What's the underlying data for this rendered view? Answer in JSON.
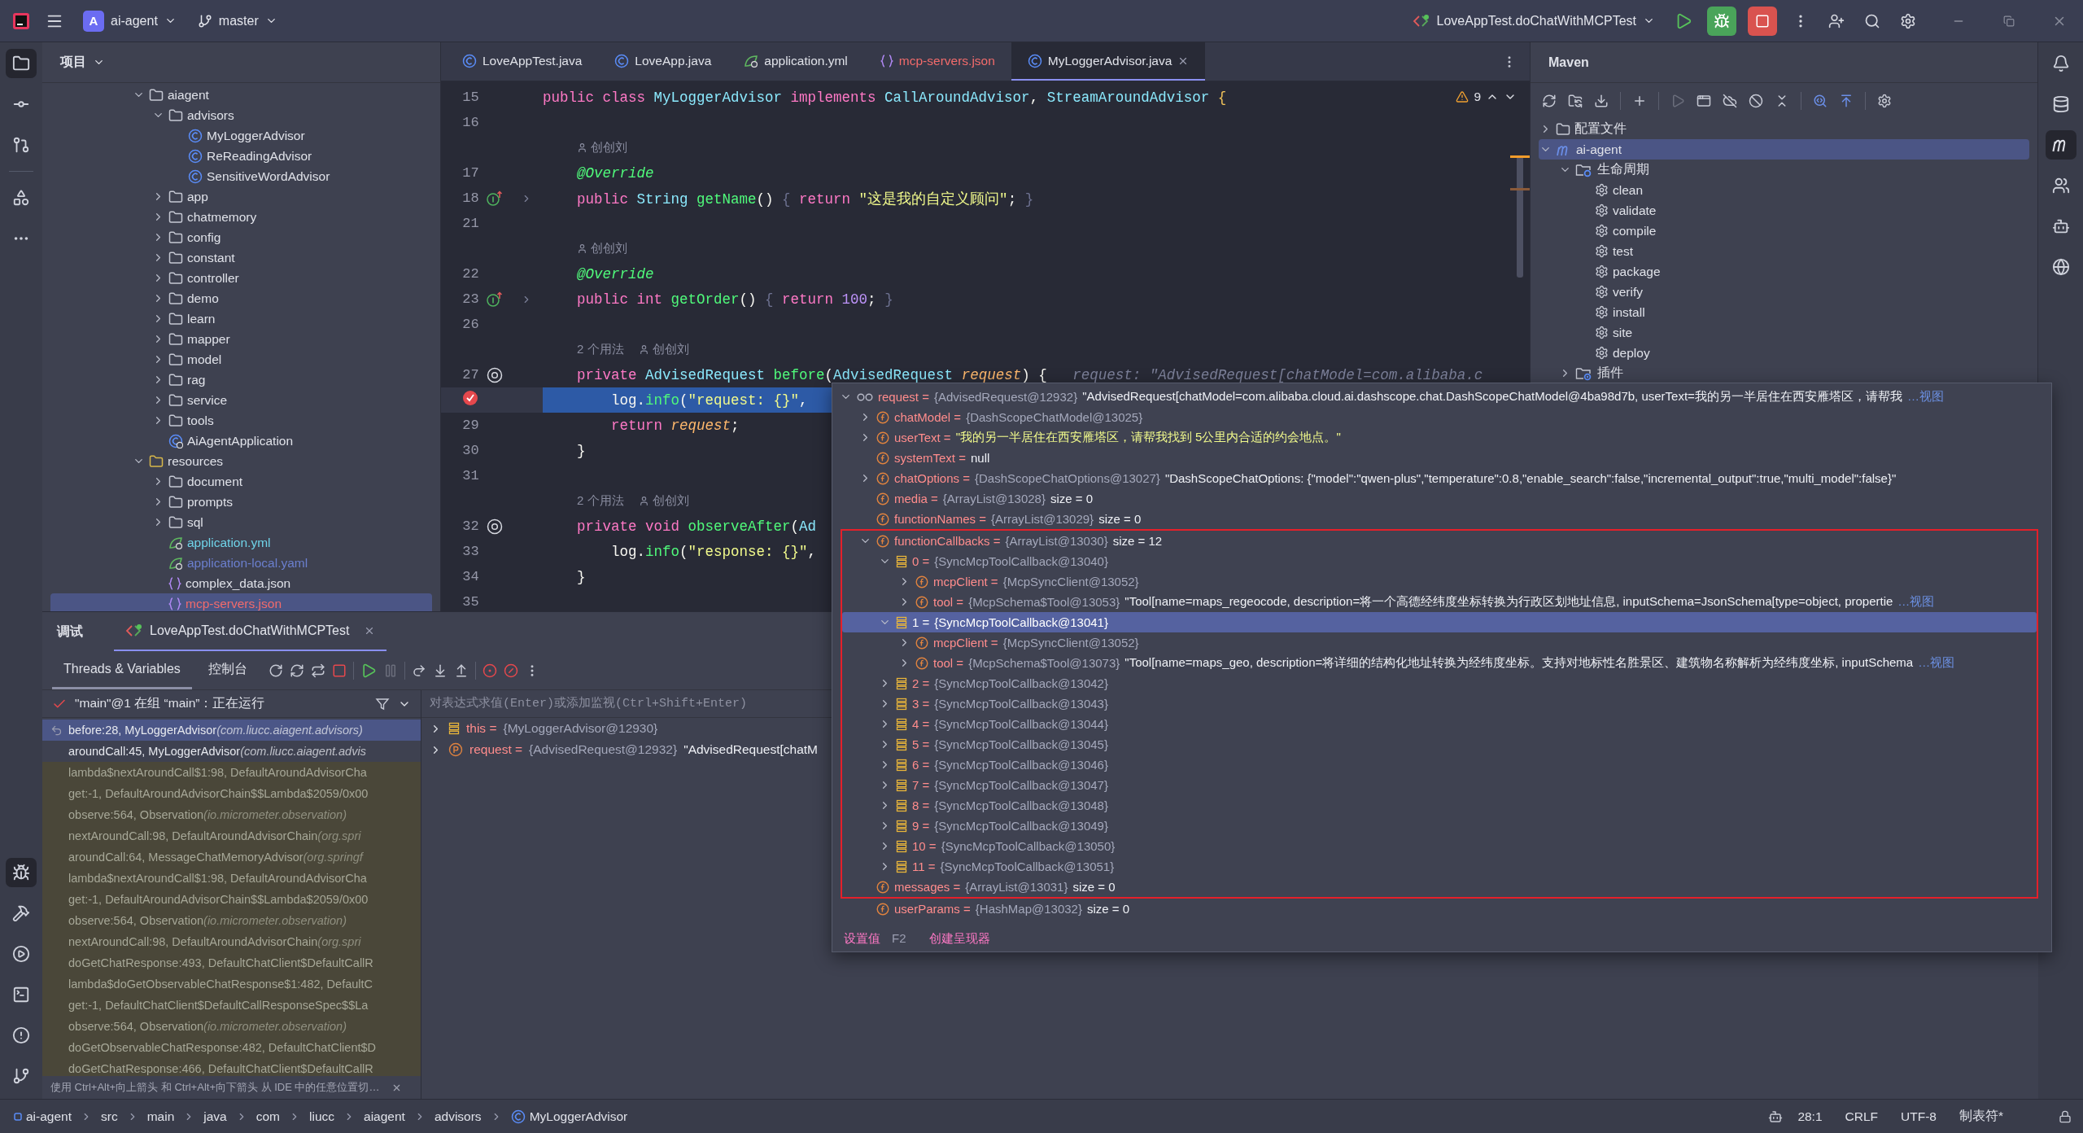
{
  "title_bar": {
    "project_badge": "A",
    "project": "ai-agent",
    "branch": "master",
    "run_config": "LoveAppTest.doChatWithMCPTest"
  },
  "project_panel": {
    "title": "项目",
    "tree": [
      {
        "label": "aiagent",
        "kind": "package",
        "expanded": true,
        "children": [
          {
            "label": "advisors",
            "kind": "package",
            "expanded": true,
            "children": [
              {
                "label": "MyLoggerAdvisor",
                "kind": "class"
              },
              {
                "label": "ReReadingAdvisor",
                "kind": "class"
              },
              {
                "label": "SensitiveWordAdvisor",
                "kind": "class"
              }
            ]
          },
          {
            "label": "app",
            "kind": "package",
            "expanded": false
          },
          {
            "label": "chatmemory",
            "kind": "package",
            "expanded": false
          },
          {
            "label": "config",
            "kind": "package",
            "expanded": false
          },
          {
            "label": "constant",
            "kind": "package",
            "expanded": false
          },
          {
            "label": "controller",
            "kind": "package",
            "expanded": false
          },
          {
            "label": "demo",
            "kind": "package",
            "expanded": false
          },
          {
            "label": "learn",
            "kind": "package",
            "expanded": false
          },
          {
            "label": "mapper",
            "kind": "package",
            "expanded": false
          },
          {
            "label": "model",
            "kind": "package",
            "expanded": false
          },
          {
            "label": "rag",
            "kind": "package",
            "expanded": false
          },
          {
            "label": "service",
            "kind": "package",
            "expanded": false
          },
          {
            "label": "tools",
            "kind": "package",
            "expanded": false
          },
          {
            "label": "AiAgentApplication",
            "kind": "app-class"
          }
        ]
      },
      {
        "label": "resources",
        "kind": "resources",
        "expanded": true,
        "children": [
          {
            "label": "document",
            "kind": "folder",
            "expanded": false,
            "selected": false
          },
          {
            "label": "prompts",
            "kind": "folder",
            "expanded": false,
            "selected": false
          },
          {
            "label": "sql",
            "kind": "folder",
            "expanded": false,
            "selected": false
          },
          {
            "label": "application.yml",
            "kind": "spring",
            "color": "#6fd3e8",
            "selected": false
          },
          {
            "label": "application-local.yaml",
            "kind": "spring",
            "color": "#6b7fce",
            "selected": false
          },
          {
            "label": "complex_data.json",
            "kind": "json",
            "selected": false
          },
          {
            "label": "mcp-servers.json",
            "kind": "json",
            "color": "#f26b6b",
            "selected": true
          }
        ]
      }
    ]
  },
  "editor": {
    "tabs": [
      {
        "label": "LoveAppTest.java",
        "kind": "java",
        "selected": false
      },
      {
        "label": "LoveApp.java",
        "kind": "java",
        "selected": false
      },
      {
        "label": "application.yml",
        "kind": "yaml",
        "selected": false
      },
      {
        "label": "mcp-servers.json",
        "kind": "json",
        "color": "#f26b6b",
        "selected": false
      },
      {
        "label": "MyLoggerAdvisor.java",
        "kind": "java",
        "selected": true
      }
    ],
    "problems": "9",
    "lines": [
      {
        "kind": "code",
        "number": "15",
        "segments": [
          {
            "kind": "kw",
            "text": "public class "
          },
          {
            "kind": "type",
            "text": "MyLoggerAdvisor"
          },
          {
            "kind": "kw",
            "text": " implements "
          },
          {
            "kind": "type",
            "text": "CallAroundAdvisor"
          },
          {
            "kind": "plain",
            "text": ", "
          },
          {
            "kind": "type",
            "text": "StreamAroundAdvisor"
          },
          {
            "kind": "brace",
            "text": " {"
          }
        ]
      },
      {
        "kind": "code",
        "number": "16"
      },
      {
        "kind": "hint",
        "author": "创创刘"
      },
      {
        "kind": "code",
        "number": "17",
        "segments": [
          {
            "kind": "ann",
            "text": "    @Override"
          }
        ]
      },
      {
        "kind": "code",
        "number": "18",
        "gutter": {
          "kind": "override"
        },
        "fold": true,
        "segments": [
          {
            "kind": "kw",
            "text": "    public "
          },
          {
            "kind": "type",
            "text": "String "
          },
          {
            "kind": "fn",
            "text": "getName"
          },
          {
            "kind": "plain",
            "text": "() "
          },
          {
            "kind": "fold",
            "text": "{ "
          },
          {
            "kind": "kw",
            "text": "return "
          },
          {
            "kind": "str",
            "text": "\"这是我的自定义顾问\""
          },
          {
            "kind": "plain",
            "text": "; "
          },
          {
            "kind": "fold",
            "text": "}"
          }
        ]
      },
      {
        "kind": "code",
        "number": "21"
      },
      {
        "kind": "hint",
        "author": "创创刘"
      },
      {
        "kind": "code",
        "number": "22",
        "segments": [
          {
            "kind": "ann",
            "text": "    @Override"
          }
        ]
      },
      {
        "kind": "code",
        "number": "23",
        "gutter": {
          "kind": "override"
        },
        "fold": true,
        "segments": [
          {
            "kind": "kw",
            "text": "    public int "
          },
          {
            "kind": "fn",
            "text": "getOrder"
          },
          {
            "kind": "plain",
            "text": "() "
          },
          {
            "kind": "fold",
            "text": "{ "
          },
          {
            "kind": "kw",
            "text": "return "
          },
          {
            "kind": "num",
            "text": "100"
          },
          {
            "kind": "plain",
            "text": "; "
          },
          {
            "kind": "fold",
            "text": "}"
          }
        ]
      },
      {
        "kind": "code",
        "number": "26"
      },
      {
        "kind": "hint",
        "usages": "2 个用法",
        "author": "创创刘"
      },
      {
        "kind": "code",
        "number": "27",
        "gutter": {
          "kind": "mapping"
        },
        "segments": [
          {
            "kind": "kw",
            "text": "    private "
          },
          {
            "kind": "type",
            "text": "AdvisedRequest "
          },
          {
            "kind": "fn",
            "text": "before"
          },
          {
            "kind": "plain",
            "text": "("
          },
          {
            "kind": "type",
            "text": "AdvisedRequest "
          },
          {
            "kind": "param",
            "text": "request"
          },
          {
            "kind": "plain",
            "text": ") {"
          },
          {
            "kind": "hint",
            "text": "   request: \"AdvisedRequest[chatModel=com.alibaba.c"
          }
        ]
      },
      {
        "kind": "code",
        "breakpoint": true,
        "current": true,
        "segments": [
          {
            "kind": "plain",
            "text": "        log."
          },
          {
            "kind": "fn",
            "text": "info"
          },
          {
            "kind": "plain",
            "text": "("
          },
          {
            "kind": "str",
            "text": "\"request: {}\""
          },
          {
            "kind": "plain",
            "text": ","
          }
        ]
      },
      {
        "kind": "code",
        "number": "29",
        "segments": [
          {
            "kind": "kw",
            "text": "        return "
          },
          {
            "kind": "param",
            "text": "request"
          },
          {
            "kind": "plain",
            "text": ";"
          }
        ]
      },
      {
        "kind": "code",
        "number": "30",
        "segments": [
          {
            "kind": "plain",
            "text": "    }"
          }
        ]
      },
      {
        "kind": "code",
        "number": "31"
      },
      {
        "kind": "hint",
        "usages": "2 个用法",
        "author": "创创刘"
      },
      {
        "kind": "code",
        "number": "32",
        "gutter": {
          "kind": "mapping"
        },
        "segments": [
          {
            "kind": "kw",
            "text": "    private void "
          },
          {
            "kind": "fn",
            "text": "observeAfter"
          },
          {
            "kind": "plain",
            "text": "("
          },
          {
            "kind": "type",
            "text": "Ad"
          }
        ]
      },
      {
        "kind": "code",
        "number": "33",
        "segments": [
          {
            "kind": "plain",
            "text": "        log."
          },
          {
            "kind": "fn",
            "text": "info"
          },
          {
            "kind": "plain",
            "text": "("
          },
          {
            "kind": "str",
            "text": "\"response: {}\""
          },
          {
            "kind": "plain",
            "text": ","
          }
        ]
      },
      {
        "kind": "code",
        "number": "34",
        "segments": [
          {
            "kind": "plain",
            "text": "    }"
          }
        ]
      },
      {
        "kind": "code",
        "number": "35"
      }
    ]
  },
  "maven": {
    "title": "Maven",
    "tree": [
      {
        "label": "配置文件",
        "kind": "profiles",
        "expanded": false,
        "selected": false
      },
      {
        "label": "ai-agent",
        "kind": "project",
        "expanded": true,
        "selected": true,
        "children": [
          {
            "label": "生命周期",
            "kind": "lifecycle",
            "expanded": true,
            "children": [
              {
                "label": "clean",
                "kind": "goal"
              },
              {
                "label": "validate",
                "kind": "goal"
              },
              {
                "label": "compile",
                "kind": "goal"
              },
              {
                "label": "test",
                "kind": "goal"
              },
              {
                "label": "package",
                "kind": "goal"
              },
              {
                "label": "verify",
                "kind": "goal"
              },
              {
                "label": "install",
                "kind": "goal"
              },
              {
                "label": "site",
                "kind": "goal"
              },
              {
                "label": "deploy",
                "kind": "goal"
              }
            ]
          },
          {
            "label": "插件",
            "kind": "plugins",
            "expanded": false
          }
        ]
      }
    ]
  },
  "debug": {
    "title": "调试",
    "session": {
      "label": "LoveAppTest.doChatWithMCPTest",
      "selected": true
    },
    "subtabs": [
      {
        "label": "Threads & Variables",
        "selected": true
      },
      {
        "label": "控制台",
        "selected": false
      }
    ],
    "thread": "\"main\"@1 在组 “main”：正在运行",
    "frames": [
      {
        "method": "before:28, MyLoggerAdvisor ",
        "package": "(com.liucc.aiagent.advisors)",
        "kind": "project",
        "selected": true
      },
      {
        "method": "aroundCall:45, MyLoggerAdvisor ",
        "package": "(com.liucc.aiagent.advis",
        "kind": "project",
        "selected": false
      },
      {
        "method": "lambda$nextAroundCall$1:98, DefaultAroundAdvisorCha",
        "kind": "library",
        "selected": false
      },
      {
        "method": "get:-1, DefaultAroundAdvisorChain$$Lambda$2059/0x00",
        "kind": "library",
        "selected": false
      },
      {
        "method": "observe:564, Observation ",
        "package": "(io.micrometer.observation)",
        "kind": "library",
        "selected": false
      },
      {
        "method": "nextAroundCall:98, DefaultAroundAdvisorChain ",
        "package": "(org.spri",
        "kind": "library",
        "selected": false
      },
      {
        "method": "aroundCall:64, MessageChatMemoryAdvisor ",
        "package": "(org.springf",
        "kind": "library",
        "selected": false
      },
      {
        "method": "lambda$nextAroundCall$1:98, DefaultAroundAdvisorCha",
        "kind": "library",
        "selected": false
      },
      {
        "method": "get:-1, DefaultAroundAdvisorChain$$Lambda$2059/0x00",
        "kind": "library",
        "selected": false
      },
      {
        "method": "observe:564, Observation ",
        "package": "(io.micrometer.observation)",
        "kind": "library",
        "selected": false
      },
      {
        "method": "nextAroundCall:98, DefaultAroundAdvisorChain ",
        "package": "(org.spri",
        "kind": "library",
        "selected": false
      },
      {
        "method": "doGetChatResponse:493, DefaultChatClient$DefaultCallR",
        "kind": "library",
        "selected": false
      },
      {
        "method": "lambda$doGetObservableChatResponse$1:482, DefaultC",
        "kind": "library",
        "selected": false
      },
      {
        "method": "get:-1, DefaultChatClient$DefaultCallResponseSpec$$La",
        "kind": "library",
        "selected": false
      },
      {
        "method": "observe:564, Observation ",
        "package": "(io.micrometer.observation)",
        "kind": "library",
        "selected": false
      },
      {
        "method": "doGetObservableChatResponse:482, DefaultChatClient$D",
        "kind": "library",
        "selected": false
      },
      {
        "method": "doGetChatResponse:466, DefaultChatClient$DefaultCallR",
        "kind": "library",
        "selected": false
      }
    ],
    "hint": "使用 Ctrl+Alt+向上箭头 和 Ctrl+Alt+向下箭头 从 IDE 中的任意位置切…",
    "evaluate": {
      "placeholder": "对表达式求值(Enter)或添加监视(Ctrl+Shift+Enter)"
    },
    "variables": [
      {
        "name": "this =",
        "type": "{MyLoggerAdvisor@12930}",
        "kind": "object",
        "expanded": false
      },
      {
        "name": "request =",
        "type": "{AdvisedRequest@12932}",
        "value": "\"AdvisedRequest[chatM",
        "kind": "param",
        "expanded": false
      }
    ]
  },
  "popup": {
    "tree": [
      {
        "name": "request =",
        "kind": "watch",
        "expanded": true,
        "type": "{AdvisedRequest@12932}",
        "value": "\"AdvisedRequest[chatModel=com.alibaba.cloud.ai.dashscope.chat.DashScopeChatModel@4ba98d7b, userText=我的另一半居住在西安雁塔区，请帮我",
        "link": "…视图",
        "children": [
          {
            "name": "chatModel =",
            "kind": "field",
            "expanded": false,
            "type": "{DashScopeChatModel@13025}"
          },
          {
            "name": "userText =",
            "kind": "field",
            "expanded": false,
            "is_string": true,
            "value": "\"我的另一半居住在西安雁塔区，请帮我找到 5公里内合适的约会地点。\""
          },
          {
            "name": "systemText =",
            "kind": "field",
            "value": "null"
          },
          {
            "name": "chatOptions =",
            "kind": "field",
            "expanded": false,
            "type": "{DashScopeChatOptions@13027}",
            "value": "\"DashScopeChatOptions: {\"model\":\"qwen-plus\",\"temperature\":0.8,\"enable_search\":false,\"incremental_output\":true,\"multi_model\":false}\""
          },
          {
            "name": "media =",
            "kind": "field",
            "type": "{ArrayList@13028}",
            "value": "size = 0"
          },
          {
            "name": "functionNames =",
            "kind": "field",
            "type": "{ArrayList@13029}",
            "value": "size = 0"
          },
          {
            "name": "functionCallbacks =",
            "kind": "field",
            "expanded": true,
            "annotated": true,
            "type": "{ArrayList@13030}",
            "value": "size = 12",
            "children": [
              {
                "name": "0 =",
                "kind": "element",
                "expanded": true,
                "selected": false,
                "type": "{SyncMcpToolCallback@13040}",
                "children": [
                  {
                    "name": "mcpClient =",
                    "kind": "field",
                    "expanded": false,
                    "type": "{McpSyncClient@13052}"
                  },
                  {
                    "name": "tool =",
                    "kind": "field",
                    "expanded": false,
                    "type": "{McpSchema$Tool@13053}",
                    "value": "\"Tool[name=maps_regeocode, description=将一个高德经纬度坐标转换为行政区划地址信息, inputSchema=JsonSchema[type=object, propertie",
                    "link": "…视图"
                  }
                ]
              },
              {
                "name": "1 =",
                "kind": "element",
                "expanded": true,
                "selected": true,
                "type": "{SyncMcpToolCallback@13041}",
                "children": [
                  {
                    "name": "mcpClient =",
                    "kind": "field",
                    "expanded": false,
                    "type": "{McpSyncClient@13052}"
                  },
                  {
                    "name": "tool =",
                    "kind": "field",
                    "expanded": false,
                    "type": "{McpSchema$Tool@13073}",
                    "value": "\"Tool[name=maps_geo, description=将详细的结构化地址转换为经纬度坐标。支持对地标性名胜景区、建筑物名称解析为经纬度坐标, inputSchema",
                    "link": "…视图"
                  }
                ]
              },
              {
                "name": "2 =",
                "kind": "element",
                "expanded": false,
                "selected": false,
                "type": "{SyncMcpToolCallback@13042}"
              },
              {
                "name": "3 =",
                "kind": "element",
                "expanded": false,
                "selected": false,
                "type": "{SyncMcpToolCallback@13043}"
              },
              {
                "name": "4 =",
                "kind": "element",
                "expanded": false,
                "selected": false,
                "type": "{SyncMcpToolCallback@13044}"
              },
              {
                "name": "5 =",
                "kind": "element",
                "expanded": false,
                "selected": false,
                "type": "{SyncMcpToolCallback@13045}"
              },
              {
                "name": "6 =",
                "kind": "element",
                "expanded": false,
                "selected": false,
                "type": "{SyncMcpToolCallback@13046}"
              },
              {
                "name": "7 =",
                "kind": "element",
                "expanded": false,
                "selected": false,
                "type": "{SyncMcpToolCallback@13047}"
              },
              {
                "name": "8 =",
                "kind": "element",
                "expanded": false,
                "selected": false,
                "type": "{SyncMcpToolCallback@13048}"
              },
              {
                "name": "9 =",
                "kind": "element",
                "expanded": false,
                "selected": false,
                "type": "{SyncMcpToolCallback@13049}"
              },
              {
                "name": "10 =",
                "kind": "element",
                "expanded": false,
                "selected": false,
                "type": "{SyncMcpToolCallback@13050}"
              },
              {
                "name": "11 =",
                "kind": "element",
                "expanded": false,
                "selected": false,
                "type": "{SyncMcpToolCallback@13051}"
              }
            ]
          },
          {
            "name": "messages =",
            "kind": "field",
            "annotated": true,
            "type": "{ArrayList@13031}",
            "value": "size = 0"
          },
          {
            "name": "userParams =",
            "kind": "field",
            "type": "{HashMap@13032}",
            "value": "size = 0"
          }
        ]
      }
    ],
    "actions": [
      {
        "label": "设置值",
        "shortcut": "F2"
      },
      {
        "label": "创建呈现器"
      }
    ]
  },
  "status_bar": {
    "breadcrumbs": [
      {
        "label": "ai-agent",
        "kind": "module"
      },
      {
        "label": "src",
        "kind": "dir"
      },
      {
        "label": "main",
        "kind": "dir"
      },
      {
        "label": "java",
        "kind": "dir"
      },
      {
        "label": "com",
        "kind": "dir"
      },
      {
        "label": "liucc",
        "kind": "dir"
      },
      {
        "label": "aiagent",
        "kind": "dir"
      },
      {
        "label": "advisors",
        "kind": "dir"
      },
      {
        "label": "MyLoggerAdvisor",
        "kind": "class"
      }
    ],
    "position": "28:1",
    "line_ending": "CRLF",
    "encoding": "UTF-8",
    "indent": "制表符*"
  }
}
